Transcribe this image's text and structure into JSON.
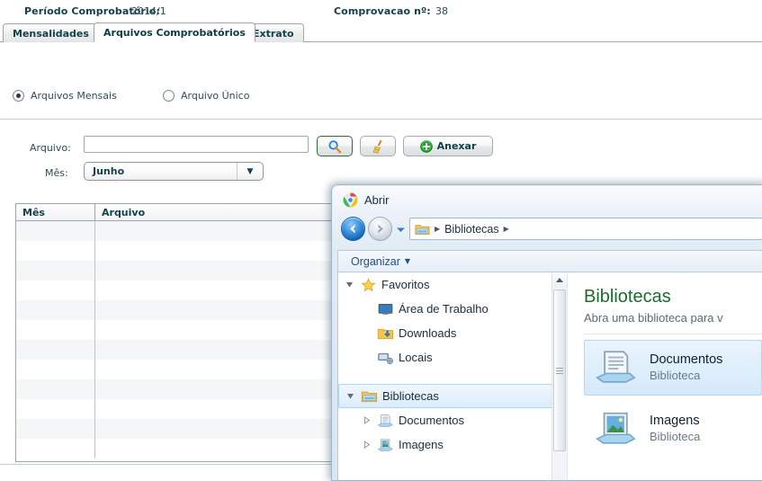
{
  "app": {
    "header": {
      "periodo_label": "Período Comprobatório:",
      "periodo_value": "2014/1",
      "comprovacao_label": "Comprovacao nº:",
      "comprovacao_value": "38"
    },
    "tabs": [
      {
        "label": "Mensalidades",
        "active": false
      },
      {
        "label": "Arquivos Comprobatórios",
        "active": true
      },
      {
        "label": "Extrato",
        "active": false
      }
    ],
    "radios": [
      {
        "label": "Arquivos Mensais",
        "checked": true
      },
      {
        "label": "Arquivo Único",
        "checked": false
      }
    ],
    "form": {
      "arquivo_label": "Arquivo:",
      "arquivo_value": "",
      "arquivo_placeholder": "",
      "mes_label": "Mês:",
      "mes_value": "Junho",
      "search_icon": "magnifier-icon",
      "clear_icon": "broom-icon",
      "anexar_label": "Anexar",
      "anexar_icon": "plus-circle-icon"
    },
    "table": {
      "columns": [
        "Mês",
        "Arquivo"
      ],
      "rows": [
        [
          "",
          ""
        ],
        [
          "",
          ""
        ],
        [
          "",
          ""
        ],
        [
          "",
          ""
        ],
        [
          "",
          ""
        ],
        [
          "",
          ""
        ],
        [
          "",
          ""
        ],
        [
          "",
          ""
        ],
        [
          "",
          ""
        ],
        [
          "",
          ""
        ],
        [
          "",
          ""
        ],
        [
          "",
          ""
        ]
      ]
    },
    "colors": {
      "text": "#13414c",
      "accent_green": "#2f6b34"
    }
  },
  "dialog": {
    "title": "Abrir",
    "title_icon": "chrome-icon",
    "nav": {
      "back_icon": "arrow-left-icon",
      "forward_icon": "arrow-right-icon",
      "recent_icon": "chevron-down-icon",
      "breadcrumb_folder_icon": "folder-library-icon",
      "breadcrumb_text": "Bibliotecas",
      "breadcrumb_sep": "▶"
    },
    "toolbar": {
      "organizar_label": "Organizar",
      "caret": "▼"
    },
    "tree": [
      {
        "label": "Favoritos",
        "icon": "star-icon",
        "level": 0,
        "twisty": "expanded",
        "selected": false
      },
      {
        "label": "Área de Trabalho",
        "icon": "desktop-icon",
        "level": 1,
        "twisty": "none",
        "selected": false
      },
      {
        "label": "Downloads",
        "icon": "downloads-folder-icon",
        "level": 1,
        "twisty": "none",
        "selected": false
      },
      {
        "label": "Locais",
        "icon": "network-places-icon",
        "level": 1,
        "twisty": "none",
        "selected": false
      },
      {
        "label": "",
        "icon": "none",
        "level": 0,
        "twisty": "none",
        "selected": false
      },
      {
        "label": "Bibliotecas",
        "icon": "library-folder-icon",
        "level": 0,
        "twisty": "expanded",
        "selected": true
      },
      {
        "label": "Documentos",
        "icon": "documents-library-icon",
        "level": 1,
        "twisty": "collapsed",
        "selected": false
      },
      {
        "label": "Imagens",
        "icon": "pictures-library-icon",
        "level": 1,
        "twisty": "collapsed",
        "selected": false
      }
    ],
    "content": {
      "heading": "Bibliotecas",
      "subtitle": "Abra uma biblioteca para v",
      "items": [
        {
          "name": "Documentos",
          "kind": "Biblioteca",
          "icon": "documents-library-icon",
          "selected": true
        },
        {
          "name": "Imagens",
          "kind": "Biblioteca",
          "icon": "pictures-library-icon",
          "selected": false
        }
      ]
    },
    "scrollbar": {
      "up_icon": "scroll-up-arrow-icon",
      "grip_icon": "scroll-grip-icon"
    }
  }
}
